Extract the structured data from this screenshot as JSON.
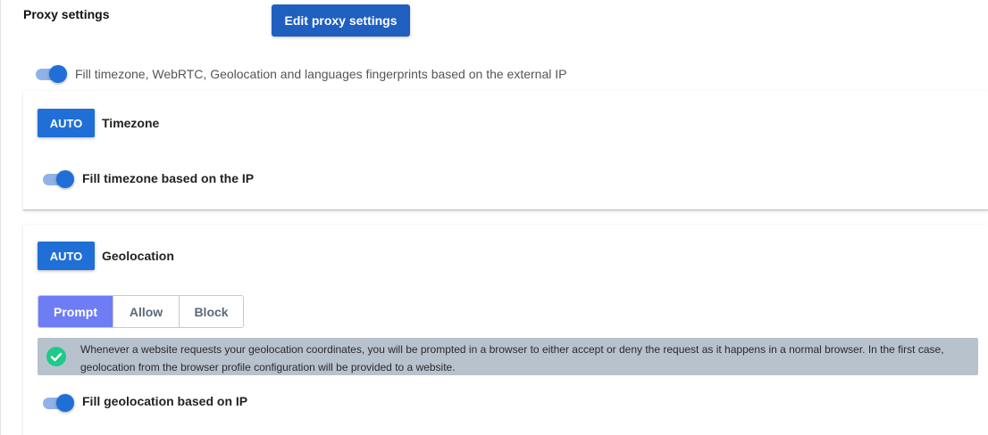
{
  "section": {
    "title": "Proxy settings",
    "edit_button": "Edit proxy settings"
  },
  "fill_from_ip": {
    "label": "Fill timezone, WebRTC, Geolocation and languages fingerprints based on the external IP",
    "enabled": true
  },
  "timezone": {
    "mode_button": "AUTO",
    "title": "Timezone",
    "toggle_label": "Fill timezone based on the IP",
    "toggle_enabled": true
  },
  "geolocation": {
    "mode_button": "AUTO",
    "title": "Geolocation",
    "options": [
      "Prompt",
      "Allow",
      "Block"
    ],
    "selected": "Prompt",
    "info_text": "Whenever a website requests your geolocation coordinates, you will be prompted in a browser to either accept or deny the request as it happens in a normal browser. In the first case, geolocation from the browser profile configuration will be provided to a website.",
    "info_icon": "check-circle-icon",
    "toggle_label": "Fill geolocation based on IP",
    "toggle_enabled": true
  },
  "colors": {
    "primary": "#1f6fd6",
    "edit_button": "#1f5fbf",
    "segment_active": "#6f7df5",
    "info_background": "#b8c2cd",
    "check": "#1ec98a"
  }
}
